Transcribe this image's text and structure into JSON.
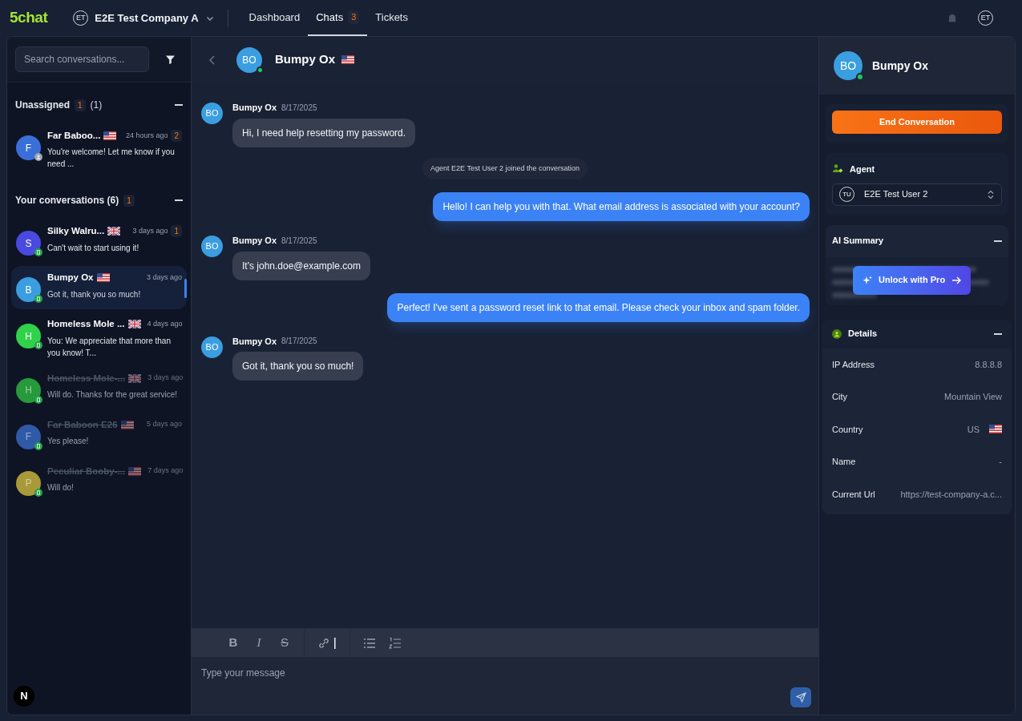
{
  "topbar": {
    "logo": "5chat",
    "company": {
      "initials": "ET",
      "name": "E2E Test Company A"
    },
    "nav": [
      {
        "label": "Dashboard",
        "selected": false
      },
      {
        "label": "Chats",
        "selected": true,
        "badge": "3"
      },
      {
        "label": "Tickets",
        "selected": false
      }
    ],
    "user_initials": "ET"
  },
  "sidebar": {
    "search": {
      "placeholder": "Search conversations..."
    },
    "groups": [
      {
        "title": "Unassigned",
        "badge": "1",
        "count": "(1)",
        "expanded": true,
        "items": [
          {
            "avatar": "F",
            "color": "#3b6fd8",
            "name": "Far Baboo...",
            "flag": {
              "kind": "us"
            },
            "time": "24 hours ago",
            "badge": "2",
            "preview": "You're welcome! Let me know if you need ...",
            "status": {
              "kind": "person"
            },
            "ended": false,
            "selected": false
          }
        ]
      },
      {
        "title": "Your conversations (6)",
        "badge": "1",
        "expanded": true,
        "items": [
          {
            "avatar": "S",
            "color": "#4a4ae0",
            "name": "Silky Walru...",
            "flag": {
              "kind": "uk"
            },
            "time": "3 days ago",
            "badge": "1",
            "preview": "Can't wait to start using it!",
            "status": {
              "kind": "online"
            },
            "ended": false,
            "selected": false
          },
          {
            "avatar": "B",
            "color": "#3a9ee0",
            "name": "Bumpy Ox",
            "flag": {
              "kind": "us"
            },
            "time": "3 days ago",
            "preview": "Got it, thank you so much!",
            "status": {
              "kind": "online"
            },
            "ended": false,
            "selected": true
          },
          {
            "avatar": "H",
            "color": "#2fd24a",
            "name": "Homeless Mole ...",
            "flag": {
              "kind": "uk"
            },
            "time": "4 days ago",
            "preview": "You: We appreciate that more than you know! T...",
            "status": {
              "kind": "online"
            },
            "ended": false,
            "selected": false
          },
          {
            "avatar": "H",
            "color": "#279a3c",
            "name": "Homeless Mole-...",
            "flag": {
              "kind": "uk"
            },
            "time": "3 days ago",
            "preview": "Will do. Thanks for the great service!",
            "status": {
              "kind": "online"
            },
            "ended": true,
            "selected": false
          },
          {
            "avatar": "F",
            "color": "#2f5aa8",
            "name": "Far Baboon E26",
            "flag": {
              "kind": "us"
            },
            "time": "5 days ago",
            "preview": "Yes please!",
            "status": {
              "kind": "online"
            },
            "ended": true,
            "selected": false
          },
          {
            "avatar": "P",
            "color": "#a89a38",
            "name": "Peculiar Booby-...",
            "flag": {
              "kind": "us"
            },
            "time": "7 days ago",
            "preview": "Will do!",
            "status": {
              "kind": "online"
            },
            "ended": true,
            "selected": false
          }
        ]
      }
    ],
    "footer_badge": "N"
  },
  "chat": {
    "header": {
      "initials": "BO",
      "name": "Bumpy Ox",
      "flag": {
        "kind": "us"
      },
      "online": true
    },
    "messages": [
      {
        "kind": "customer",
        "initials": "BO",
        "author": "Bumpy Ox",
        "date": "8/17/2025",
        "text": "Hi, I need help resetting my password."
      },
      {
        "kind": "system",
        "text": "Agent E2E Test User 2 joined the conversation"
      },
      {
        "kind": "agent",
        "text": "Hello! I can help you with that. What email address is associated with your account?"
      },
      {
        "kind": "customer",
        "initials": "BO",
        "author": "Bumpy Ox",
        "date": "8/17/2025",
        "text": "It's john.doe@example.com"
      },
      {
        "kind": "agent",
        "text": "Perfect! I've sent a password reset link to that email. Please check your inbox and spam folder."
      },
      {
        "kind": "customer",
        "initials": "BO",
        "author": "Bumpy Ox",
        "date": "8/17/2025",
        "text": "Got it, thank you so much!"
      }
    ],
    "toolbar": [
      {
        "kind": "bold",
        "label": "B"
      },
      {
        "kind": "italic",
        "label": "I"
      },
      {
        "kind": "strike",
        "label": "S"
      },
      {
        "kind": "divider"
      },
      {
        "kind": "link"
      },
      {
        "kind": "divider"
      },
      {
        "kind": "bullets"
      },
      {
        "kind": "numbers"
      }
    ],
    "composer": {
      "placeholder": "Type your message"
    }
  },
  "details": {
    "initials": "BO",
    "name": "Bumpy Ox",
    "online": true,
    "end_button": "End Conversation",
    "agent": {
      "title": "Agent",
      "initials": "TU",
      "value": "E2E Test User 2"
    },
    "ai_summary": {
      "title": "AI Summary",
      "expanded": true,
      "unlock": "Unlock with Pro"
    },
    "info": {
      "title": "Details",
      "expanded": true,
      "rows": [
        {
          "label": "IP Address",
          "value": "8.8.8.8"
        },
        {
          "label": "City",
          "value": "Mountain View"
        },
        {
          "label": "Country",
          "value": "US",
          "flag": {
            "kind": "us"
          }
        },
        {
          "label": "Name",
          "value": "-"
        },
        {
          "label": "Current Url",
          "value": "https://test-company-a.c..."
        }
      ]
    }
  }
}
